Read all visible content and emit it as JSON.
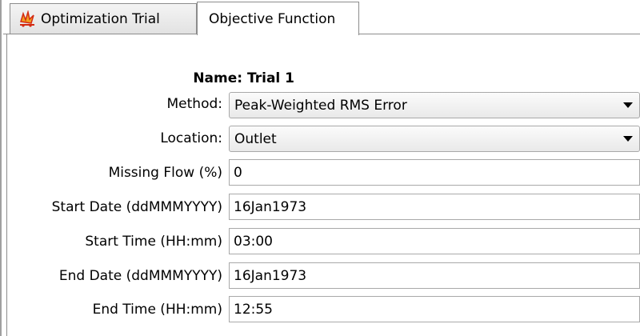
{
  "tabs": [
    {
      "label": "Optimization Trial",
      "icon": "optimization-trial-icon",
      "active": false
    },
    {
      "label": "Objective Function",
      "active": true
    }
  ],
  "form": {
    "name_label": "Name:",
    "name_value": "Trial 1",
    "method": {
      "label": "Method:",
      "value": "Peak-Weighted RMS Error"
    },
    "location": {
      "label": "Location:",
      "value": "Outlet"
    },
    "missing_flow": {
      "label": "Missing Flow (%)",
      "value": "0"
    },
    "start_date": {
      "label": "Start Date (ddMMMYYYY)",
      "value": "16Jan1973"
    },
    "start_time": {
      "label": "Start Time (HH:mm)",
      "value": "03:00"
    },
    "end_date": {
      "label": "End Date (ddMMMYYYY)",
      "value": "16Jan1973"
    },
    "end_time": {
      "label": "End Time (HH:mm)",
      "value": "12:55"
    }
  },
  "colors": {
    "border": "#8c8c8c",
    "field_border": "#a9a9a9",
    "icon_red": "#d42a12",
    "icon_orange": "#f0a020"
  }
}
